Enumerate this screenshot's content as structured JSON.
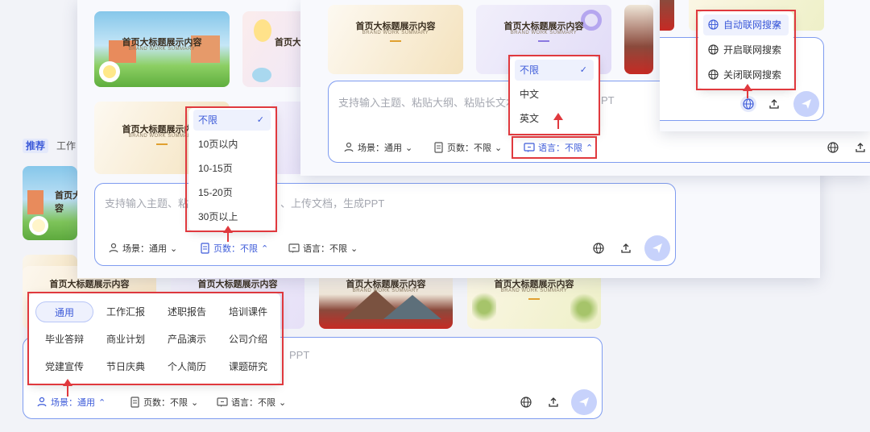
{
  "thumb": {
    "title": "首页大标题展示内容",
    "subtitle": "BRAND WORK SUMMARY"
  },
  "tabs": {
    "recommend": "推荐",
    "work": "工作"
  },
  "layer1": {
    "placeholder": "支持输入主题、粘贴大纲、粘贴长文本、上传文档，生成PPT",
    "placeholder_tail": "PPT",
    "scene_label": "场景：通用",
    "pages_label": "页数：不限",
    "lang_label": "语言：不限",
    "scene_menu": {
      "rows": [
        [
          "通用",
          "工作汇报",
          "述职报告",
          "培训课件"
        ],
        [
          "毕业答辩",
          "商业计划",
          "产品演示",
          "公司介绍"
        ],
        [
          "党建宣传",
          "节日庆典",
          "个人简历",
          "课题研究"
        ]
      ],
      "selected": "通用"
    }
  },
  "layer2": {
    "placeholder_head": "支持输入主题、粘",
    "placeholder_tail": "、上传文档，生成PPT",
    "scene_label": "场景：通用",
    "pages_label": "页数：不限",
    "lang_label": "语言：不限",
    "pages_menu": {
      "items": [
        "不限",
        "10页以内",
        "10-15页",
        "15-20页",
        "30页以上"
      ],
      "selected": "不限",
      "check": "✓"
    }
  },
  "layer3": {
    "placeholder": "支持输入主题、粘贴大纲、粘贴长文本",
    "placeholder_tail": "PT",
    "scene_label": "场景：通用",
    "pages_label": "页数：不限",
    "lang_label": "语言：不限",
    "lang_menu": {
      "items": [
        "不限",
        "中文",
        "英文"
      ],
      "selected": "不限",
      "check": "✓"
    }
  },
  "layer4": {
    "search_menu": {
      "items": [
        "自动联网搜索",
        "开启联网搜索",
        "关闭联网搜索"
      ],
      "selected": "自动联网搜索",
      "check": "✓"
    }
  },
  "colors": {
    "accent": "#3d5bd9",
    "highlight": "#e0393e",
    "send": "#c7d2fb"
  }
}
